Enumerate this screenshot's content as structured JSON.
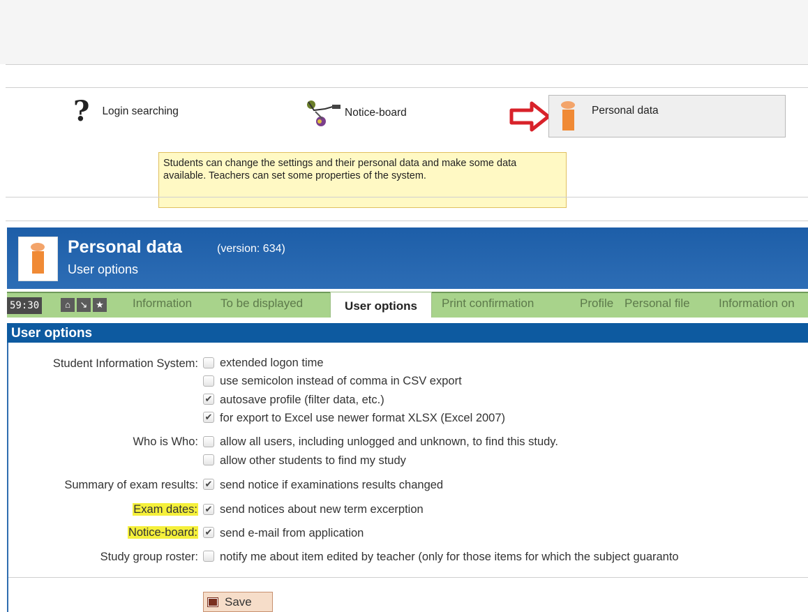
{
  "menu": {
    "login_label": "Login searching",
    "noticeboard_label": "Notice-board",
    "personal_label": "Personal data",
    "tooltip": "Students can change the settings and their personal data and make some data available. Teachers can set some properties of the system."
  },
  "header": {
    "title": "Personal data",
    "version": "(version: 634)",
    "subtitle": "User options"
  },
  "tabbar": {
    "timer": "59:30",
    "tabs": [
      "Information",
      "To be displayed",
      "User options",
      "Print confirmation",
      "Profile",
      "Personal file",
      "Information on"
    ],
    "active_tab": "User options"
  },
  "section": {
    "title": "User options"
  },
  "options": {
    "sis_label": "Student Information System:",
    "sis_1": "extended logon time",
    "sis_2": "use semicolon instead of comma in CSV export",
    "sis_3": "autosave profile (filter data, etc.)",
    "sis_4": "for export to Excel use newer format XLSX (Excel 2007)",
    "who_label": "Who is Who:",
    "who_1": "allow all users, including unlogged and unknown, to find this study.",
    "who_2": "allow other students to find my study",
    "summary_label": "Summary of exam results:",
    "summary_1": "send notice if examinations results changed",
    "exam_label": "Exam dates:",
    "exam_1": "send notices about new term excerption",
    "notice_label": "Notice-board:",
    "notice_1": "send e-mail from application",
    "roster_label": "Study group roster:",
    "roster_1": "notify me about item edited by teacher (only for those items for which the subject guaranto"
  },
  "checked": {
    "sis_1": false,
    "sis_2": false,
    "sis_3": true,
    "sis_4": true,
    "who_1": false,
    "who_2": false,
    "summary_1": true,
    "exam_1": true,
    "notice_1": true,
    "roster_1": false
  },
  "save_label": "Save",
  "colors": {
    "header_blue": "#1d5ea8",
    "tab_green": "#a8d38b",
    "highlight": "#f5f03b",
    "arrow_red": "#d8222a"
  }
}
